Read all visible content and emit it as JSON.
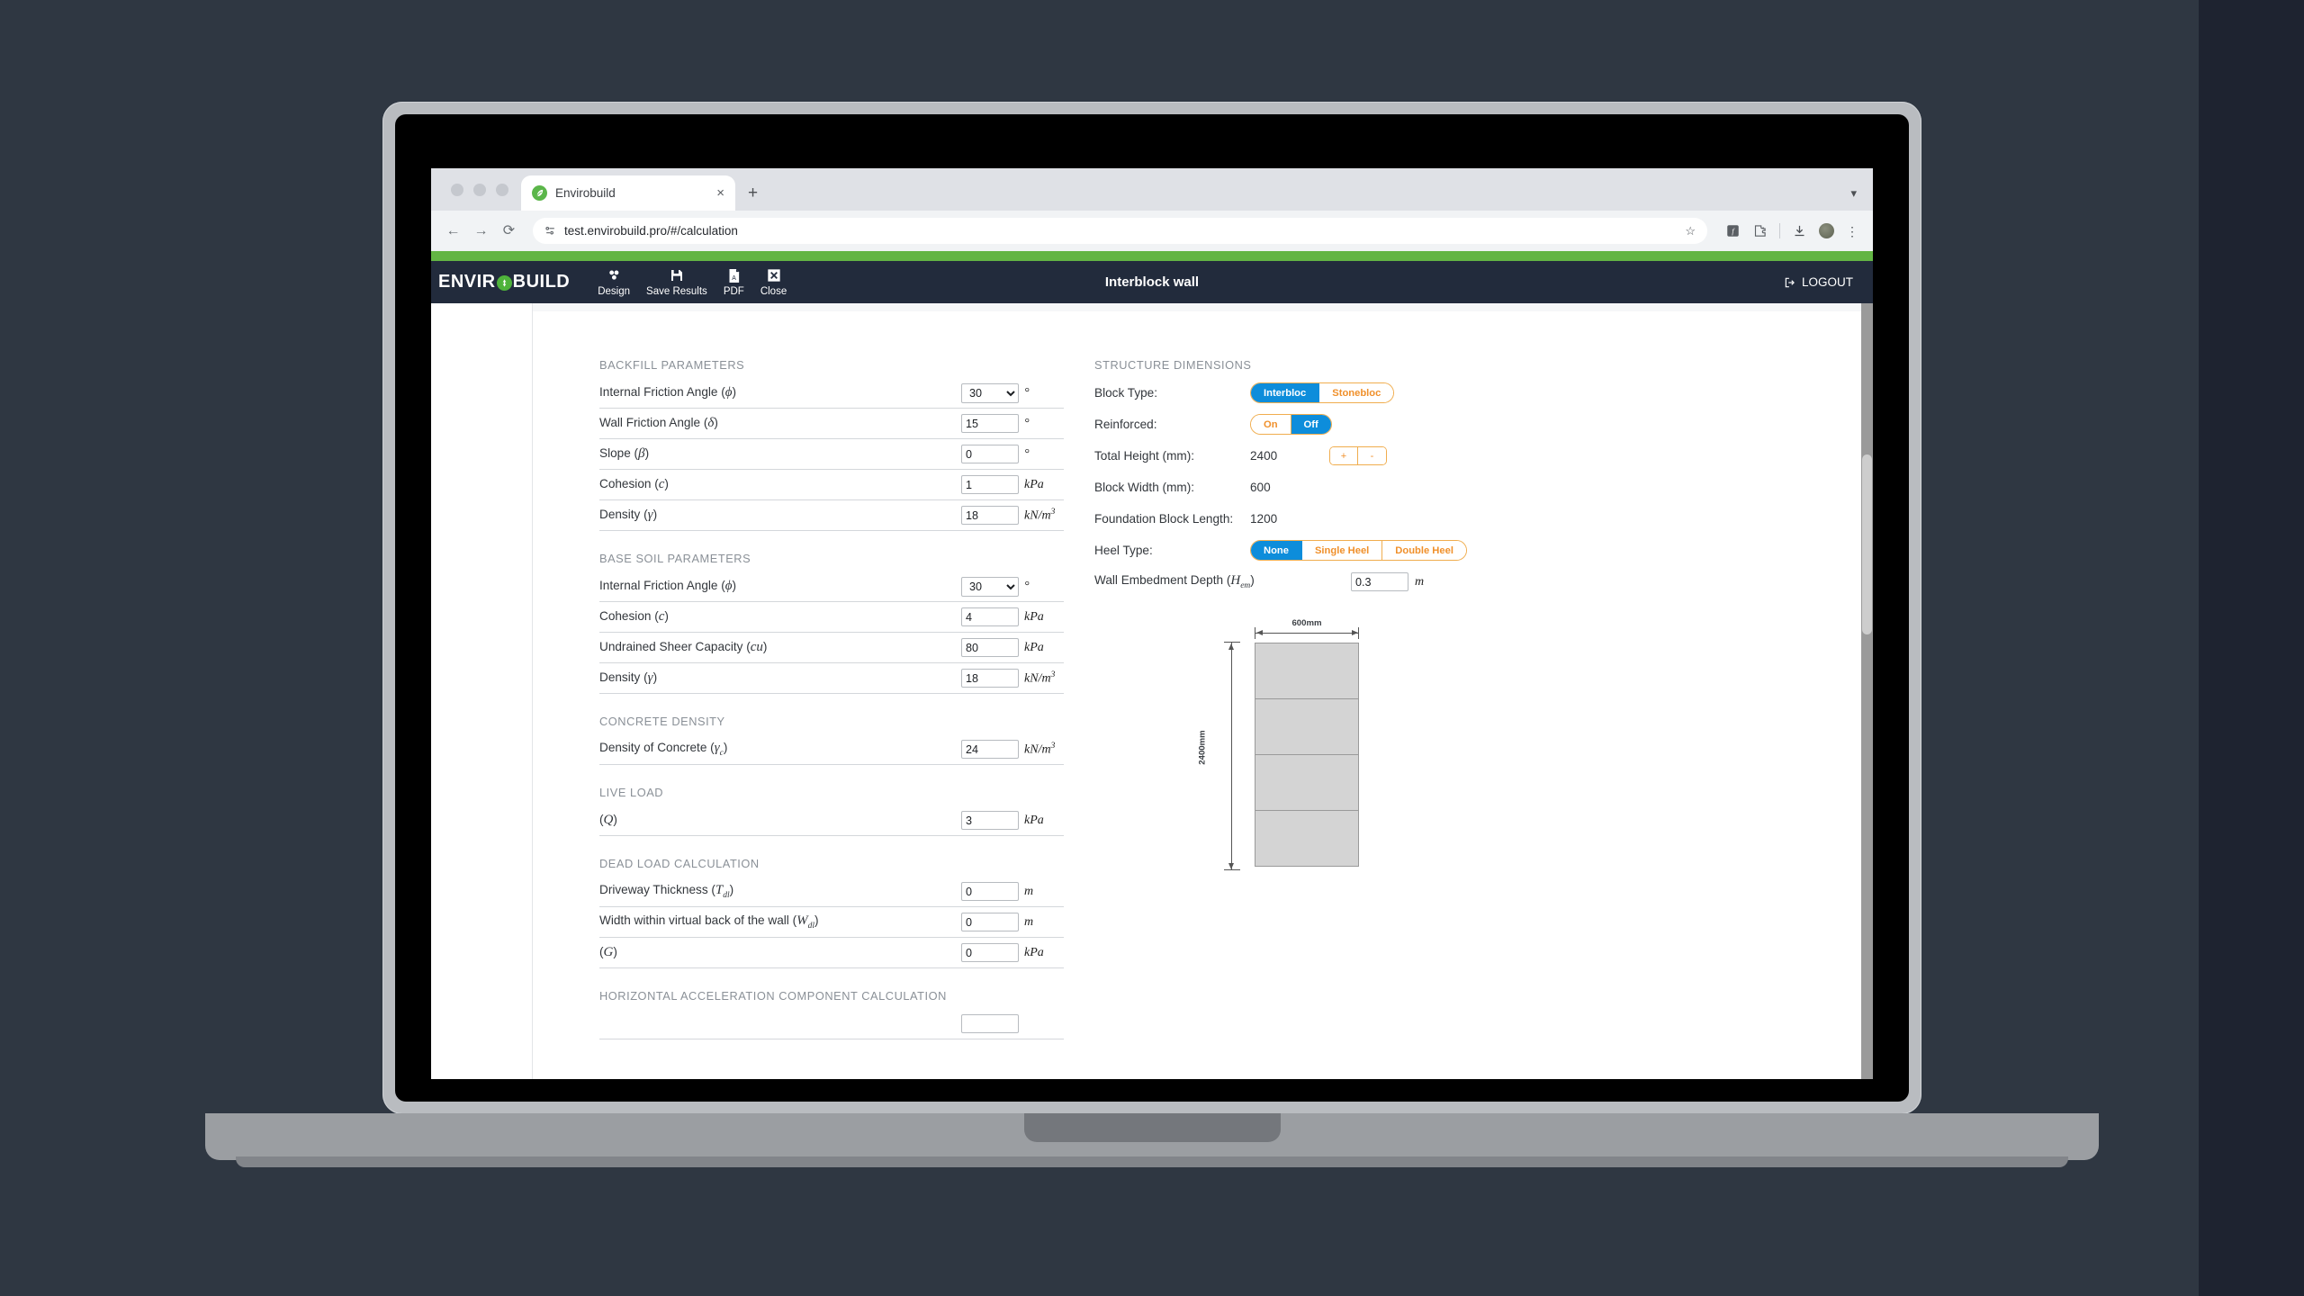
{
  "browser": {
    "tab": {
      "title": "Envirobuild",
      "favicon": "leaf-icon",
      "close": "×"
    },
    "new_tab": "+",
    "tabstrip_caret": "▾",
    "nav": {
      "back": "←",
      "forward": "→",
      "reload": "⟳"
    },
    "omnibox": {
      "url": "test.envirobuild.pro/#/calculation",
      "lock": "page-info-icon",
      "star": "☆"
    },
    "toolbar_icons": [
      "extension-f-icon",
      "extensions-puzzle-icon",
      "download-icon",
      "profile-avatar",
      "chrome-menu-kebab"
    ]
  },
  "app": {
    "logo_left": "ENVIR",
    "logo_right": "BUILD",
    "title": "Interblock wall",
    "logout_label": "LOGOUT",
    "toolbar": [
      {
        "icon": "cubes-icon",
        "label": "Design"
      },
      {
        "icon": "floppy-save-icon",
        "label": "Save Results"
      },
      {
        "icon": "pdf-file-icon",
        "label": "PDF"
      },
      {
        "icon": "close-x-box-icon",
        "label": "Close"
      }
    ]
  },
  "left": {
    "backfill": {
      "title": "Backfill Parameters",
      "rows": [
        {
          "label": "Internal Friction Angle (",
          "sym": "ϕ",
          "sub": "",
          "tail": ")",
          "value": "30",
          "unit": "°",
          "type": "select"
        },
        {
          "label": "Wall Friction Angle (",
          "sym": "δ",
          "sub": "",
          "tail": ")",
          "value": "15",
          "unit": "°",
          "type": "input"
        },
        {
          "label": "Slope (",
          "sym": "β",
          "sub": "",
          "tail": ")",
          "value": "0",
          "unit": "°",
          "type": "input"
        },
        {
          "label": "Cohesion (",
          "sym": "c",
          "sub": "",
          "tail": ")",
          "value": "1",
          "unit": "kPa",
          "type": "input"
        },
        {
          "label": "Density (",
          "sym": "γ",
          "sub": "",
          "tail": ")",
          "value": "18",
          "unit": "kN/m3",
          "type": "input"
        }
      ]
    },
    "basesoil": {
      "title": "Base Soil Parameters",
      "rows": [
        {
          "label": "Internal Friction Angle (",
          "sym": "ϕ",
          "sub": "",
          "tail": ")",
          "value": "30",
          "unit": "°",
          "type": "select"
        },
        {
          "label": "Cohesion (",
          "sym": "c",
          "sub": "",
          "tail": ")",
          "value": "4",
          "unit": "kPa",
          "type": "input"
        },
        {
          "label": "Undrained Sheer Capacity (",
          "sym": "cu",
          "sub": "",
          "tail": ")",
          "value": "80",
          "unit": "kPa",
          "type": "input"
        },
        {
          "label": "Density (",
          "sym": "γ",
          "sub": "",
          "tail": ")",
          "value": "18",
          "unit": "kN/m3",
          "type": "input"
        }
      ]
    },
    "concrete": {
      "title": "Concrete Density",
      "rows": [
        {
          "label": "Density of Concrete (",
          "sym": "γ",
          "sub": "c",
          "tail": ")",
          "value": "24",
          "unit": "kN/m3",
          "type": "input"
        }
      ]
    },
    "liveload": {
      "title": "Live Load",
      "rows": [
        {
          "label": "(",
          "sym": "Q",
          "sub": "",
          "tail": ")",
          "value": "3",
          "unit": "kPa",
          "type": "input"
        }
      ]
    },
    "deadload": {
      "title": "Dead Load Calculation",
      "rows": [
        {
          "label": "Driveway Thickness (",
          "sym": "T",
          "sub": "dl",
          "tail": ")",
          "value": "0",
          "unit": "m",
          "type": "input"
        },
        {
          "label": "Width within virtual back of the wall (",
          "sym": "W",
          "sub": "dl",
          "tail": ")",
          "value": "0",
          "unit": "m",
          "type": "input"
        },
        {
          "label": "(",
          "sym": "G",
          "sub": "",
          "tail": ")",
          "value": "0",
          "unit": "kPa",
          "type": "input"
        }
      ]
    },
    "horizontal": {
      "title": "Horizontal Acceleration Component Calculation"
    }
  },
  "right": {
    "title": "Structure Dimensions",
    "block_type": {
      "label": "Block Type:",
      "options": [
        "Interbloc",
        "Stonebloc"
      ],
      "selected": "Interbloc"
    },
    "reinforced": {
      "label": "Reinforced:",
      "options": [
        "On",
        "Off"
      ],
      "selected": "Off"
    },
    "total_height": {
      "label": "Total Height (mm):",
      "value": "2400",
      "plus": "+",
      "minus": "-"
    },
    "block_width": {
      "label": "Block Width (mm):",
      "value": "600"
    },
    "foundation_block_length": {
      "label": "Foundation Block Length:",
      "value": "1200"
    },
    "heel_type": {
      "label": "Heel Type:",
      "options": [
        "None",
        "Single Heel",
        "Double Heel"
      ],
      "selected": "None"
    },
    "embedment": {
      "label": "Wall Embedment Depth (",
      "sym": "H",
      "sub": "em",
      "tail": ")",
      "value": "0.3",
      "unit": "m"
    },
    "diagram": {
      "width_label": "600mm",
      "height_label": "2400mm",
      "block_count": 4
    }
  },
  "colors": {
    "brand_green": "#63b544",
    "header_navy": "#222b3c",
    "accent_blue": "#0d8ddb",
    "accent_orange": "#f0902b",
    "desktop_bg": "#2f3742"
  }
}
